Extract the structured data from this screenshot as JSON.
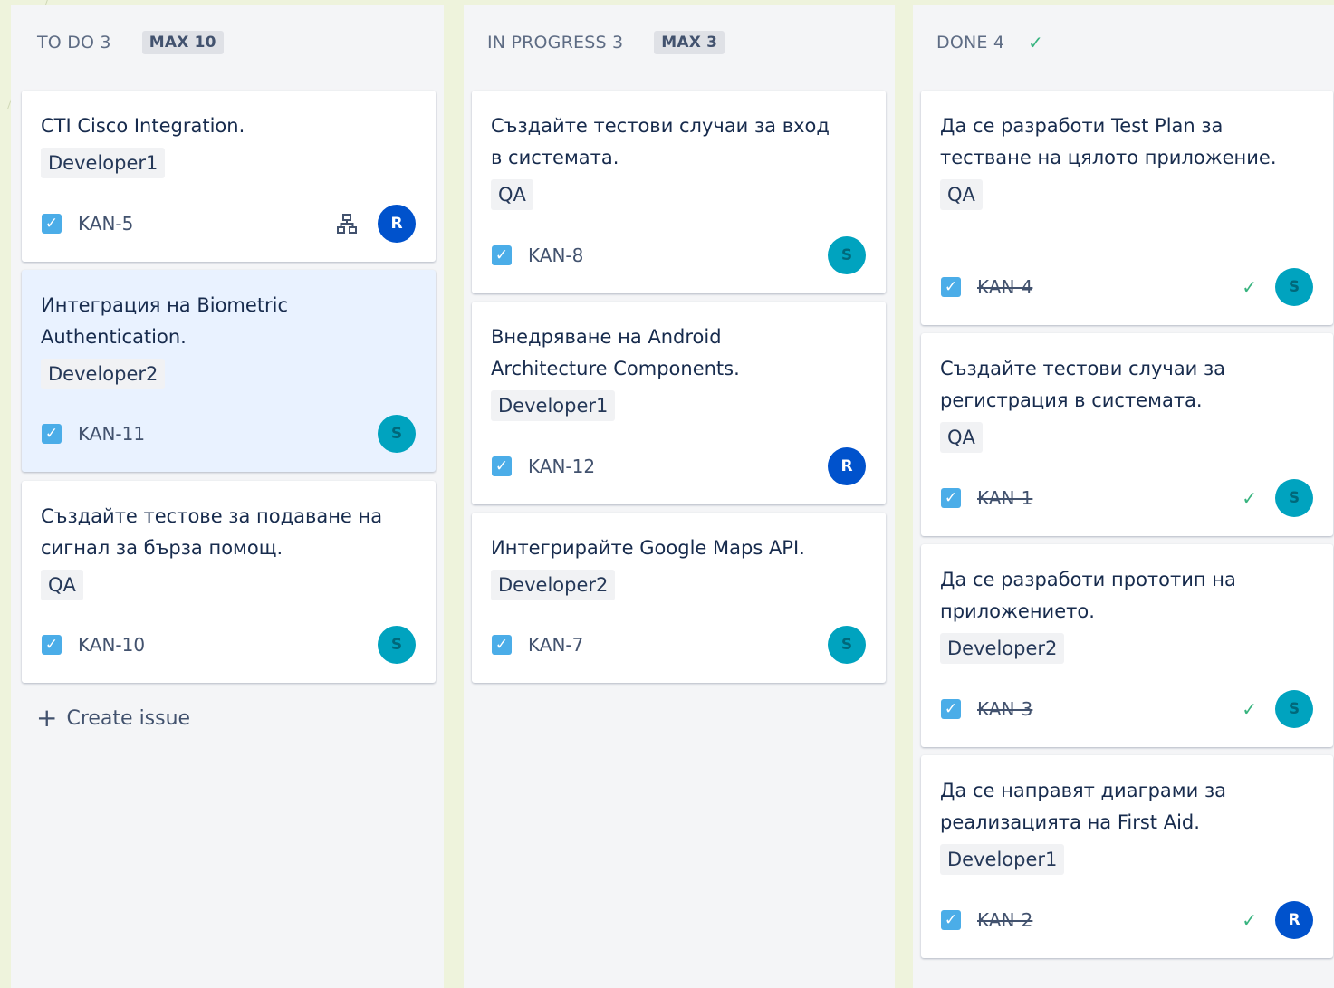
{
  "columns": [
    {
      "title": "TO DO 3",
      "limit": "MAX 10",
      "cards": [
        {
          "title": "CTI Cisco Integration.",
          "label": "Developer1",
          "key": "KAN-5",
          "assignee": "R"
        },
        {
          "title": "Интеграция на Biometric Authentication.",
          "label": "Developer2",
          "key": "KAN-11",
          "assignee": "S"
        },
        {
          "title": "Създайте тестове за подаване на сигнал за бърза помощ.",
          "label": "QA",
          "key": "KAN-10",
          "assignee": "S"
        }
      ],
      "create_issue_label": "Create issue"
    },
    {
      "title": "IN PROGRESS 3",
      "limit": "MAX 3",
      "cards": [
        {
          "title": "Създайте тестови случаи за вход в системата.",
          "label": "QA",
          "key": "KAN-8",
          "assignee": "S"
        },
        {
          "title": "Внедряване на Android Architecture Components.",
          "label": "Developer1",
          "key": "KAN-12",
          "assignee": "R"
        },
        {
          "title": "Интегрирайте Google Maps API.",
          "label": "Developer2",
          "key": "KAN-7",
          "assignee": "S"
        }
      ]
    },
    {
      "title": "DONE 4",
      "cards": [
        {
          "title": "Да се разработи Test Plan за тестване на цялото приложение.",
          "label": "QA",
          "key": "KAN-4",
          "assignee": "S"
        },
        {
          "title": "Създайте тестови случаи за регистрация в системата.",
          "label": "QA",
          "key": "KAN-1",
          "assignee": "S"
        },
        {
          "title": "Да се разработи прототип на приложението.",
          "label": "Developer2",
          "key": "KAN-3",
          "assignee": "S"
        },
        {
          "title": "Да се направят диаграми за реализацията на First Aid.",
          "label": "Developer1",
          "key": "KAN-2",
          "assignee": "R"
        }
      ]
    }
  ],
  "icons": {
    "issue_type": "checkbox-icon",
    "done_column": "checkmark-icon",
    "child_issues": "hierarchy-icon",
    "create": "plus-icon"
  },
  "colors": {
    "avatar_r": "#0052cc",
    "avatar_s": "#00a3bf",
    "issue_type": "#4bade8",
    "done_check": "#36b37e"
  }
}
